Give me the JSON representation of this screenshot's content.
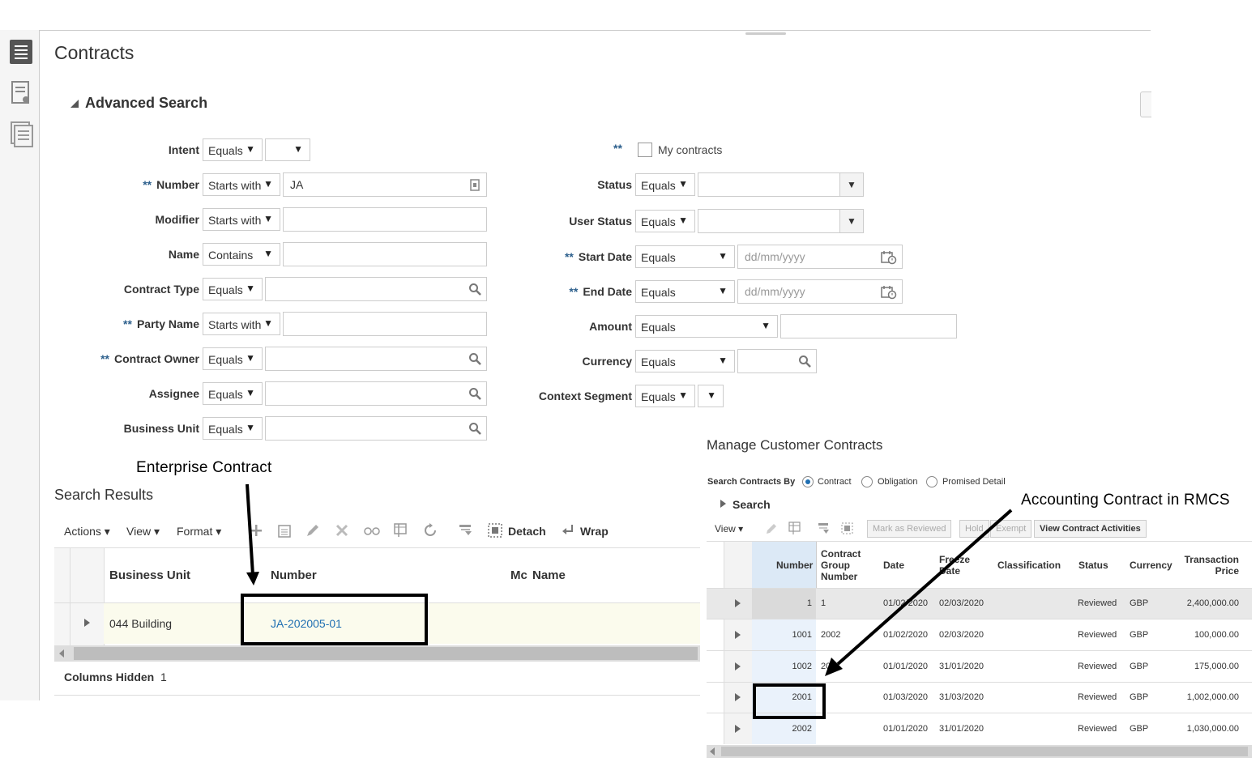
{
  "page": {
    "title": "Contracts"
  },
  "advanced_search": {
    "title": "Advanced Search",
    "required_marker": "**",
    "fields_left": [
      {
        "label": "Intent",
        "op": "Equals",
        "value": "",
        "required": false
      },
      {
        "label": "Number",
        "op": "Starts with",
        "value": "JA",
        "required": true
      },
      {
        "label": "Modifier",
        "op": "Starts with",
        "value": "",
        "required": false
      },
      {
        "label": "Name",
        "op": "Contains",
        "value": "",
        "required": false
      },
      {
        "label": "Contract Type",
        "op": "Equals",
        "value": "",
        "required": false
      },
      {
        "label": "Party Name",
        "op": "Starts with",
        "value": "",
        "required": true
      },
      {
        "label": "Contract Owner",
        "op": "Equals",
        "value": "",
        "required": true
      },
      {
        "label": "Assignee",
        "op": "Equals",
        "value": "",
        "required": false
      },
      {
        "label": "Business Unit",
        "op": "Equals",
        "value": "",
        "required": false
      }
    ],
    "my_contracts_label": "My contracts",
    "fields_right": [
      {
        "label": "Status",
        "op": "Equals"
      },
      {
        "label": "User Status",
        "op": "Equals"
      },
      {
        "label": "Start Date",
        "op": "Equals",
        "placeholder": "dd/mm/yyyy",
        "required": true
      },
      {
        "label": "End Date",
        "op": "Equals",
        "placeholder": "dd/mm/yyyy",
        "required": true
      },
      {
        "label": "Amount",
        "op": "Equals"
      },
      {
        "label": "Currency",
        "op": "Equals"
      },
      {
        "label": "Context Segment",
        "op": "Equals"
      }
    ]
  },
  "search_results": {
    "title": "Search Results",
    "toolbar": {
      "actions": "Actions",
      "view": "View",
      "format": "Format",
      "detach": "Detach",
      "wrap": "Wrap"
    },
    "columns": [
      "Business Unit",
      "Number",
      "Mc",
      "Name"
    ],
    "rows": [
      {
        "business_unit": "044 Building",
        "number": "JA-202005-01"
      }
    ],
    "columns_hidden_label": "Columns Hidden",
    "columns_hidden_count": "1"
  },
  "callouts": {
    "enterprise": "Enterprise Contract",
    "accounting": "Accounting Contract in RMCS"
  },
  "manage": {
    "title": "Manage Customer Contracts",
    "search_by_label": "Search Contracts By",
    "search_by_options": [
      "Contract",
      "Obligation",
      "Promised Detail"
    ],
    "search_label": "Search",
    "view_label": "View",
    "buttons": {
      "mark": "Mark as Reviewed",
      "hold": "Hold",
      "exempt": "Exempt",
      "view_activities": "View Contract Activities"
    },
    "columns": {
      "number": "Number",
      "group1": "Contract",
      "group2": "Group",
      "group3": "Number",
      "date": "Date",
      "freeze1": "Freeze",
      "freeze2": "Date",
      "classification": "Classification",
      "status": "Status",
      "currency": "Currency",
      "price1": "Transaction",
      "price2": "Price"
    },
    "rows": [
      {
        "number": "1",
        "group": "1",
        "date": "01/02/2020",
        "freeze": "02/03/2020",
        "status": "Reviewed",
        "currency": "GBP",
        "price": "2,400,000.00"
      },
      {
        "number": "1001",
        "group": "2002",
        "date": "01/02/2020",
        "freeze": "02/03/2020",
        "status": "Reviewed",
        "currency": "GBP",
        "price": "100,000.00"
      },
      {
        "number": "1002",
        "group": "20",
        "date": "01/01/2020",
        "freeze": "31/01/2020",
        "status": "Reviewed",
        "currency": "GBP",
        "price": "175,000.00"
      },
      {
        "number": "2001",
        "group": "",
        "date": "01/03/2020",
        "freeze": "31/03/2020",
        "status": "Reviewed",
        "currency": "GBP",
        "price": "1,002,000.00"
      },
      {
        "number": "2002",
        "group": "",
        "date": "01/01/2020",
        "freeze": "31/01/2020",
        "status": "Reviewed",
        "currency": "GBP",
        "price": "1,030,000.00"
      }
    ]
  }
}
